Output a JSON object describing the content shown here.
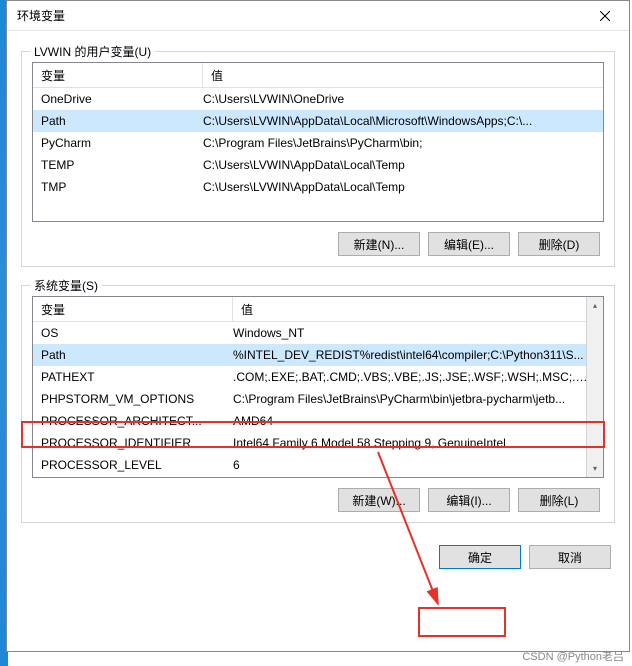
{
  "dialog": {
    "title": "环境变量",
    "close_label": "×"
  },
  "user_vars": {
    "legend": "LVWIN 的用户变量(U)",
    "col_var": "变量",
    "col_val": "值",
    "rows": [
      {
        "var": "OneDrive",
        "val": "C:\\Users\\LVWIN\\OneDrive"
      },
      {
        "var": "Path",
        "val": "C:\\Users\\LVWIN\\AppData\\Local\\Microsoft\\WindowsApps;C:\\..."
      },
      {
        "var": "PyCharm",
        "val": "C:\\Program Files\\JetBrains\\PyCharm\\bin;"
      },
      {
        "var": "TEMP",
        "val": "C:\\Users\\LVWIN\\AppData\\Local\\Temp"
      },
      {
        "var": "TMP",
        "val": "C:\\Users\\LVWIN\\AppData\\Local\\Temp"
      }
    ],
    "btn_new": "新建(N)...",
    "btn_edit": "编辑(E)...",
    "btn_delete": "删除(D)"
  },
  "sys_vars": {
    "legend": "系统变量(S)",
    "col_var": "变量",
    "col_val": "值",
    "rows": [
      {
        "var": "OS",
        "val": "Windows_NT"
      },
      {
        "var": "Path",
        "val": "%INTEL_DEV_REDIST%redist\\intel64\\compiler;C:\\Python311\\S..."
      },
      {
        "var": "PATHEXT",
        "val": ".COM;.EXE;.BAT;.CMD;.VBS;.VBE;.JS;.JSE;.WSF;.WSH;.MSC;.PY;.P..."
      },
      {
        "var": "PHPSTORM_VM_OPTIONS",
        "val": "C:\\Program Files\\JetBrains\\PyCharm\\bin\\jetbra-pycharm\\jetb..."
      },
      {
        "var": "PROCESSOR_ARCHITECT...",
        "val": "AMD64"
      },
      {
        "var": "PROCESSOR_IDENTIFIER",
        "val": "Intel64 Family 6 Model 58 Stepping 9, GenuineIntel"
      },
      {
        "var": "PROCESSOR_LEVEL",
        "val": "6"
      }
    ],
    "btn_new": "新建(W)...",
    "btn_edit": "编辑(I)...",
    "btn_delete": "删除(L)"
  },
  "footer": {
    "ok": "确定",
    "cancel": "取消"
  },
  "watermark": "CSDN @Python老吕"
}
